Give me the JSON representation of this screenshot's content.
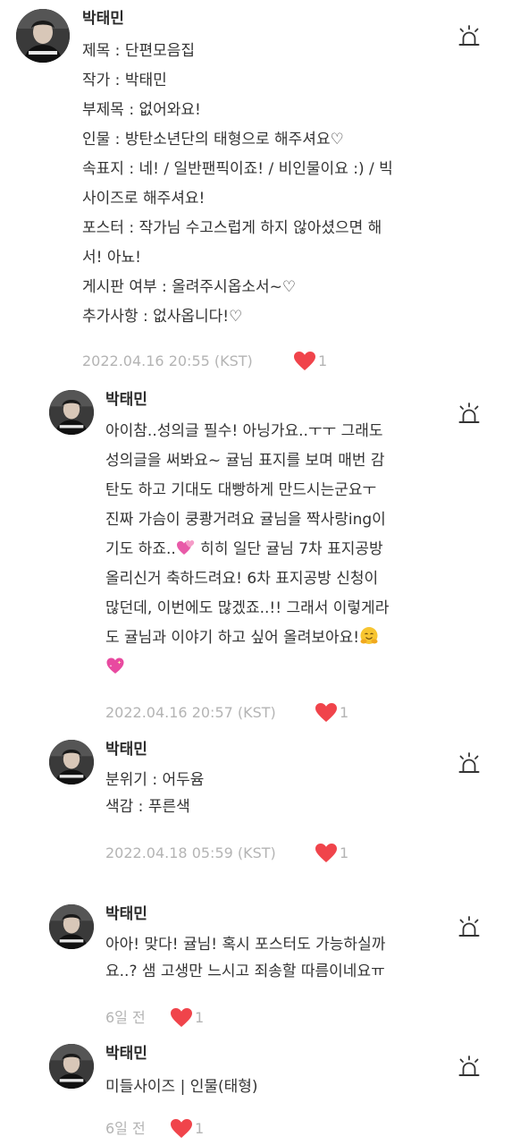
{
  "comments": [
    {
      "author": "박태민",
      "lines": [
        "제목 : 단편모음집",
        "작가 : 박태민",
        "부제목 : 없어와요!",
        "인물 : 방탄소년단의 태형으로 해주셔요♡",
        "속표지 : 네! / 일반팬픽이죠! / 비인물이요 :) / 빅",
        "사이즈로 해주셔요!",
        "포스터 : 작가님 수고스럽게 하지 않아셨으면 해",
        "서! 아뇨!",
        "게시판 여부 : 올려주시옵소서~♡",
        "추가사항 : 없사옵니다!♡"
      ],
      "timestamp": "2022.04.16 20:55 (KST)",
      "likes": "1"
    },
    {
      "author": "박태민",
      "lines": [
        "아이참..성의글 필수! 아닝가요..ㅜㅜ 그래도",
        "성의글을 써봐요~ 귤님 표지를 보며 매번 감",
        "탄도 하고 기대도 대빵하게 만드시는군요ㅜ",
        "진짜 가슴이 쿵쾅거려요 귤님을 짝사랑ing이",
        "기도 하죠..",
        "올리신거 축하드려요! 6차 표지공방 신청이",
        "많던데, 이번에도 많겠죠..!! 그래서 이렇게라",
        "도 귤님과 이야기 하고 싶어 올려보아요!"
      ],
      "line5_suffix": " 히히 일단 귤님 7차 표지공방",
      "timestamp": "2022.04.16 20:57 (KST)",
      "likes": "1"
    },
    {
      "author": "박태민",
      "lines": [
        "분위기 : 어두윰",
        "색감 : 푸른색"
      ],
      "timestamp": "2022.04.18 05:59 (KST)",
      "likes": "1"
    },
    {
      "author": "박태민",
      "lines": [
        "아아! 맞다! 귤님! 혹시 포스터도 가능하실까",
        "요..? 샘 고생만 느시고 죄송할 따름이네요ㅠ"
      ],
      "timestamp": "6일 전",
      "likes": "1"
    },
    {
      "author": "박태민",
      "lines": [
        "미들사이즈 | 인물(태형)"
      ],
      "timestamp": "6일 전",
      "likes": "1"
    }
  ],
  "icons": {
    "report": "siren-icon",
    "like": "heart-icon",
    "emoji_hearts": "two-hearts-emoji",
    "emoji_hug": "hugging-face-emoji",
    "emoji_sparkle_heart": "sparkling-heart-emoji"
  },
  "colors": {
    "heart": "#f0444b",
    "meta_text": "#b4b4b4"
  }
}
